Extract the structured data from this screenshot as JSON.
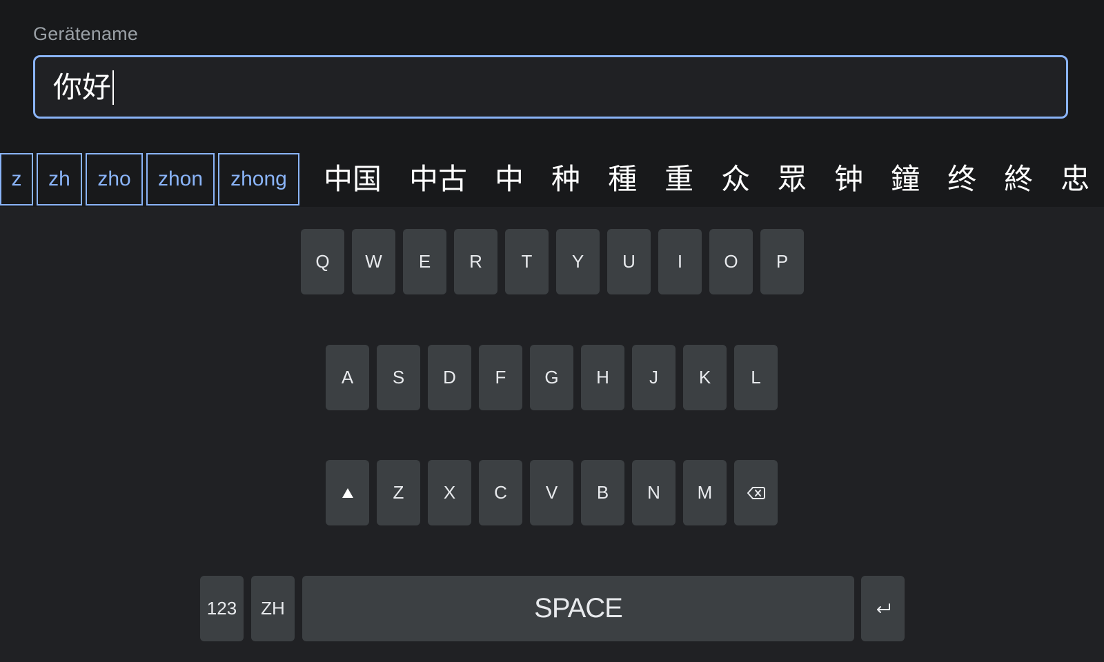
{
  "field": {
    "label": "Gerätename",
    "value": "你好"
  },
  "pinyin_chips": [
    "z",
    "zh",
    "zho",
    "zhon",
    "zhong"
  ],
  "candidates": [
    "中国",
    "中古",
    "中",
    "种",
    "種",
    "重",
    "众",
    "眾",
    "钟",
    "鐘",
    "终",
    "終",
    "忠"
  ],
  "keyboard": {
    "row1": [
      "Q",
      "W",
      "E",
      "R",
      "T",
      "Y",
      "U",
      "I",
      "O",
      "P"
    ],
    "row2": [
      "A",
      "S",
      "D",
      "F",
      "G",
      "H",
      "J",
      "K",
      "L"
    ],
    "row3": [
      "Z",
      "X",
      "C",
      "V",
      "B",
      "N",
      "M"
    ],
    "numbers_label": "123",
    "lang_label": "ZH",
    "space_label": "SPACE",
    "shift_icon": "shift-icon",
    "backspace_icon": "backspace-icon",
    "enter_icon": "enter-icon"
  }
}
